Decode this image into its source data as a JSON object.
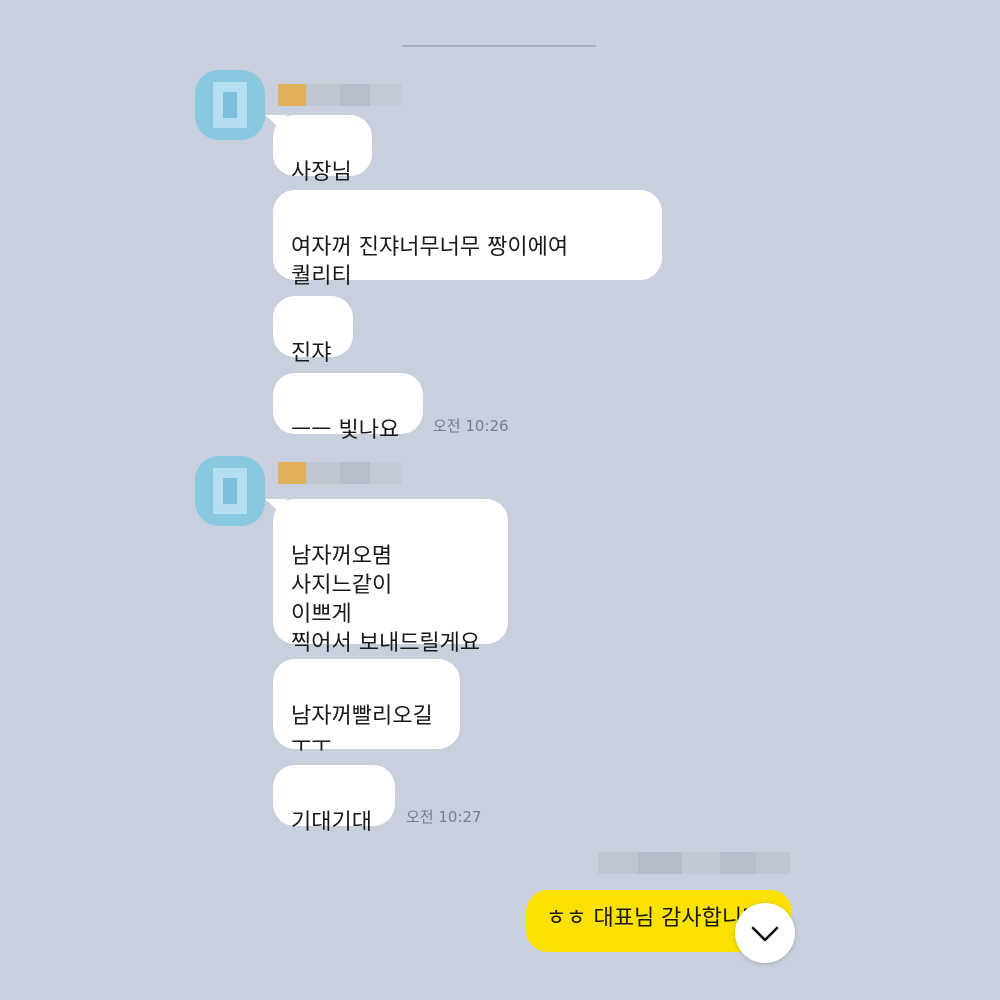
{
  "groups": [
    {
      "messages": [
        {
          "text": "사장님"
        },
        {
          "text": "여자꺼 진쟈너무너무 짱이에여\n퀄리티"
        },
        {
          "text": "진쟈"
        },
        {
          "text": "ㅡㅡ 빛나요"
        }
      ],
      "time": "오전 10:26"
    },
    {
      "messages": [
        {
          "text": "남자꺼오몀\n사지느같이\n이쁘게\n찍어서 보내드릴게요"
        },
        {
          "text": "남자꺼빨리오길\nㅜㅜ"
        },
        {
          "text": "기대기대"
        }
      ],
      "time": "오전 10:27"
    }
  ],
  "my_message": {
    "text": "ㅎㅎ 대표님 감사합니다"
  },
  "icons": {
    "avatar": "avatar-pixelated",
    "scroll_down": "chevron-down-icon"
  },
  "colors": {
    "chat_background": "#c8d0dd",
    "incoming_bubble": "#ffffff",
    "outgoing_bubble": "#fae100"
  }
}
